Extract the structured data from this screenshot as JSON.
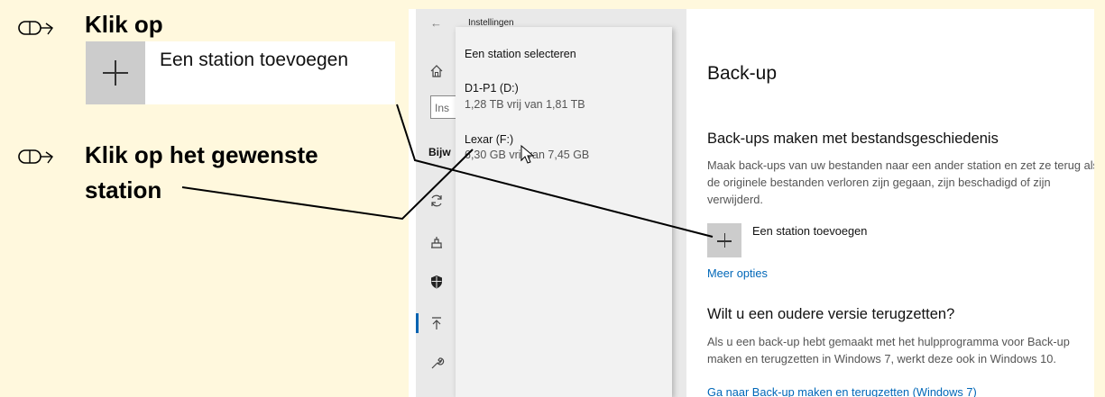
{
  "instructions": {
    "step1": "Klik op",
    "step1_button_label": "Een station toevoegen",
    "step2_line1": "Klik op het gewenste",
    "step2_line2": "station"
  },
  "settings": {
    "window_title": "Instellingen",
    "search_placeholder": "Ins",
    "sidebar_section": "Bijw",
    "popup": {
      "title": "Een station selecteren",
      "drives": [
        {
          "name": "D1-P1 (D:)",
          "size": "1,28 TB  vrij van 1,81 TB"
        },
        {
          "name": "Lexar (F:)",
          "size": "6,30 GB  vrij van 7,45 GB"
        }
      ]
    },
    "page_title": "Back-up",
    "file_history": {
      "heading": "Back-ups maken met bestandsgeschiedenis",
      "description": "Maak back-ups van uw bestanden naar een ander station en zet ze terug als de originele bestanden verloren zijn gegaan, zijn beschadigd of zijn verwijderd.",
      "add_drive_label": "Een station toevoegen",
      "more_options": "Meer opties"
    },
    "restore": {
      "heading": "Wilt u een oudere versie terugzetten?",
      "description": "Als u een back-up hebt gemaakt met het hulpprogramma voor Back-up maken en terugzetten in Windows 7, werkt deze ook in Windows 10.",
      "link": "Ga naar Back-up maken en terugzetten (Windows 7)"
    }
  },
  "colors": {
    "instruction_bg": "#fff8dd",
    "link_blue": "#0067b8",
    "accent": "#0063b1"
  }
}
